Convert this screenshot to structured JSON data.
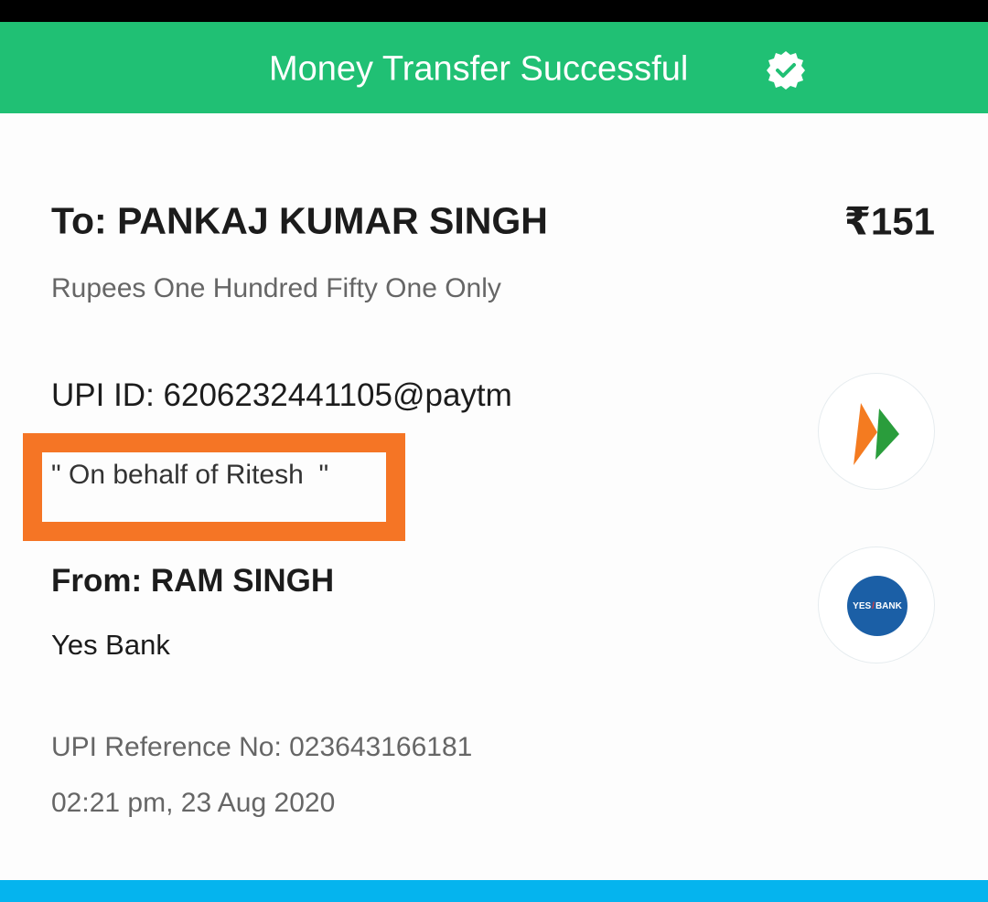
{
  "header": {
    "title": "Money Transfer Successful",
    "icon": "verified-badge-icon",
    "background": "#20c074"
  },
  "payment": {
    "to": "To: PANKAJ KUMAR SINGH",
    "amount": "₹151",
    "amount_words": "Rupees One Hundred Fifty One Only",
    "upi_id": "UPI ID: 6206232441105@paytm",
    "note": "\" On behalf of Ritesh  \"",
    "from": "From: RAM SINGH",
    "bank": "Yes Bank",
    "reference": "UPI Reference No: 023643166181",
    "datetime": "02:21 pm, 23 Aug 2020"
  },
  "logos": {
    "upi": "upi-logo-icon",
    "bank": "yes-bank-logo-icon",
    "bank_text_left": "YES",
    "bank_text_right": "BANK"
  },
  "colors": {
    "highlight": "#f57525",
    "bottom_bar": "#05b4ee"
  }
}
